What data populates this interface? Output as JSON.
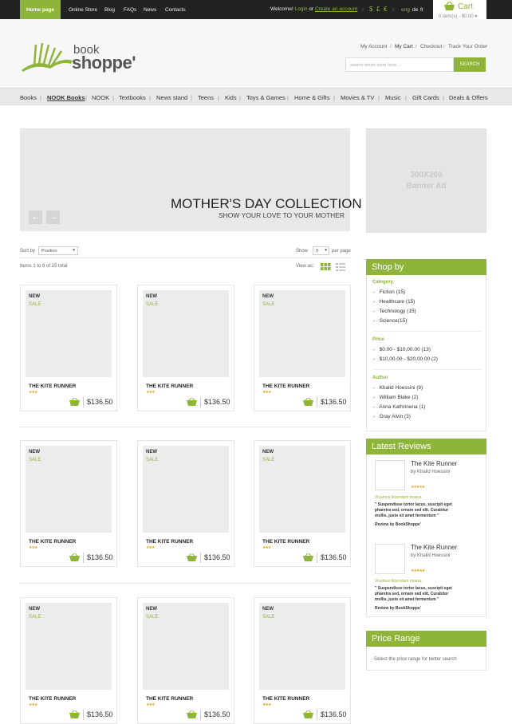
{
  "topbar": {
    "home": "Home page",
    "nav": [
      "Online Store",
      "Blog",
      "FAQs",
      "News",
      "Contacts"
    ],
    "welcome": "Welcome!",
    "login": "Login",
    "or": "or",
    "create": "Create an account",
    "currencies": [
      "$",
      "£",
      "€"
    ],
    "langs": [
      "eng",
      "de",
      "fr"
    ]
  },
  "cart": {
    "label": "Cart",
    "summary": "0 item(s) - $0.00"
  },
  "logo": {
    "word1": "book",
    "word2": "shoppe'"
  },
  "account_links": [
    "My Account",
    "My Cart",
    "Checkout",
    "Track Your Order"
  ],
  "search": {
    "placeholder": "search entire store here...",
    "button": "SEARCH"
  },
  "categories": [
    "Books",
    "NOOK Books",
    "NOOK",
    "Textbooks",
    "News stand",
    "Teens",
    "Kids",
    "Toys & Games",
    "Home & Gifts",
    "Movies & TV",
    "Music",
    "Gift Cards",
    "Deals & Offers"
  ],
  "banner": {
    "title": "MOTHER'S DAY COLLECTION",
    "subtitle": "SHOW YOUR LOVE TO YOUR MOTHER",
    "prev": "←",
    "next": "→"
  },
  "ad": {
    "line1": "300X260",
    "line2": "Banner Ad"
  },
  "toolbar": {
    "sort_label": "Sort by",
    "sort_value": "Position",
    "show_label": "Show",
    "show_value": "9",
    "per_page": "per page",
    "items": "Items 1 to 9 of 15 total",
    "view_as": "View as:"
  },
  "product": {
    "new": "NEW",
    "sale": "SALE",
    "title": "THE KITE RUNNER",
    "stars": "★★★",
    "price": "$136.50"
  },
  "shopby": {
    "title": "Shop by",
    "category_h": "Category",
    "categories": [
      "Fiction (15)",
      "Healthcare (15)",
      "Technology (15)",
      "Science(15)"
    ],
    "price_h": "Price",
    "prices": [
      "$0.00 - $10,00.00 (13)",
      "$10,00.00 - $20,00.00 (2)"
    ],
    "author_h": "Author",
    "authors": [
      "Khalid Hoessini (9)",
      "William Blake (2)",
      "Anna Kathrinena (1)",
      "Gray Alvin (3)"
    ]
  },
  "reviews": {
    "title": "Latest Reviews",
    "book": "The Kite Runner",
    "author": "by Khalid Hoessini",
    "stars": "★★★★★",
    "headline": "Vivamus bibendum massa",
    "quote1": "\" Suspendisse tortor lacus, suscipit eget",
    "quote2": "pharetra sed, ornare sed elit. Curabitur",
    "quote3": "mollis, justo sit amet fermentum \"",
    "footer": "Review by BookShoppe'"
  },
  "price_range": {
    "title": "Price Range",
    "hint": "Select the price range for better search"
  },
  "colors": {
    "accent": "#8fb43a",
    "topbar": "#222222"
  }
}
